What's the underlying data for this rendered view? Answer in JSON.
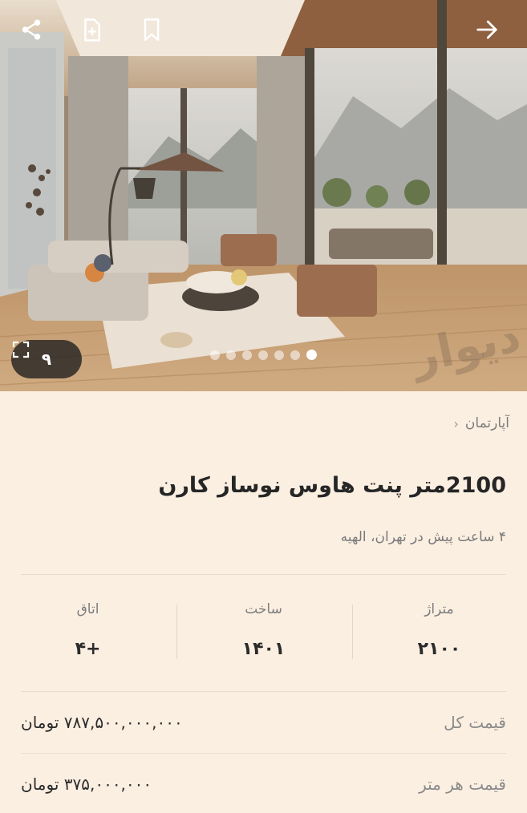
{
  "header": {
    "icons": [
      "share-icon",
      "add-note-icon",
      "bookmark-icon",
      "back-arrow-icon"
    ]
  },
  "gallery": {
    "count": "۹",
    "dots_total": 7,
    "active_dot": 1,
    "watermark": "دیوار"
  },
  "breadcrumb": {
    "category": "آپارتمان"
  },
  "listing": {
    "title": "2100متر پنت هاوس نوساز کارن",
    "subtitle": "۴ ساعت پیش در تهران، الهیه"
  },
  "stats": [
    {
      "label": "متراژ",
      "value": "۲۱۰۰"
    },
    {
      "label": "ساخت",
      "value": "۱۴۰۱"
    },
    {
      "label": "اتاق",
      "value": "+۴"
    }
  ],
  "price": {
    "total_label": "قیمت کل",
    "total_value": "۷۸۷,۵۰۰,۰۰۰,۰۰۰ تومان",
    "per_meter_label": "قیمت هر متر",
    "per_meter_value": "۳۷۵,۰۰۰,۰۰۰ تومان"
  }
}
